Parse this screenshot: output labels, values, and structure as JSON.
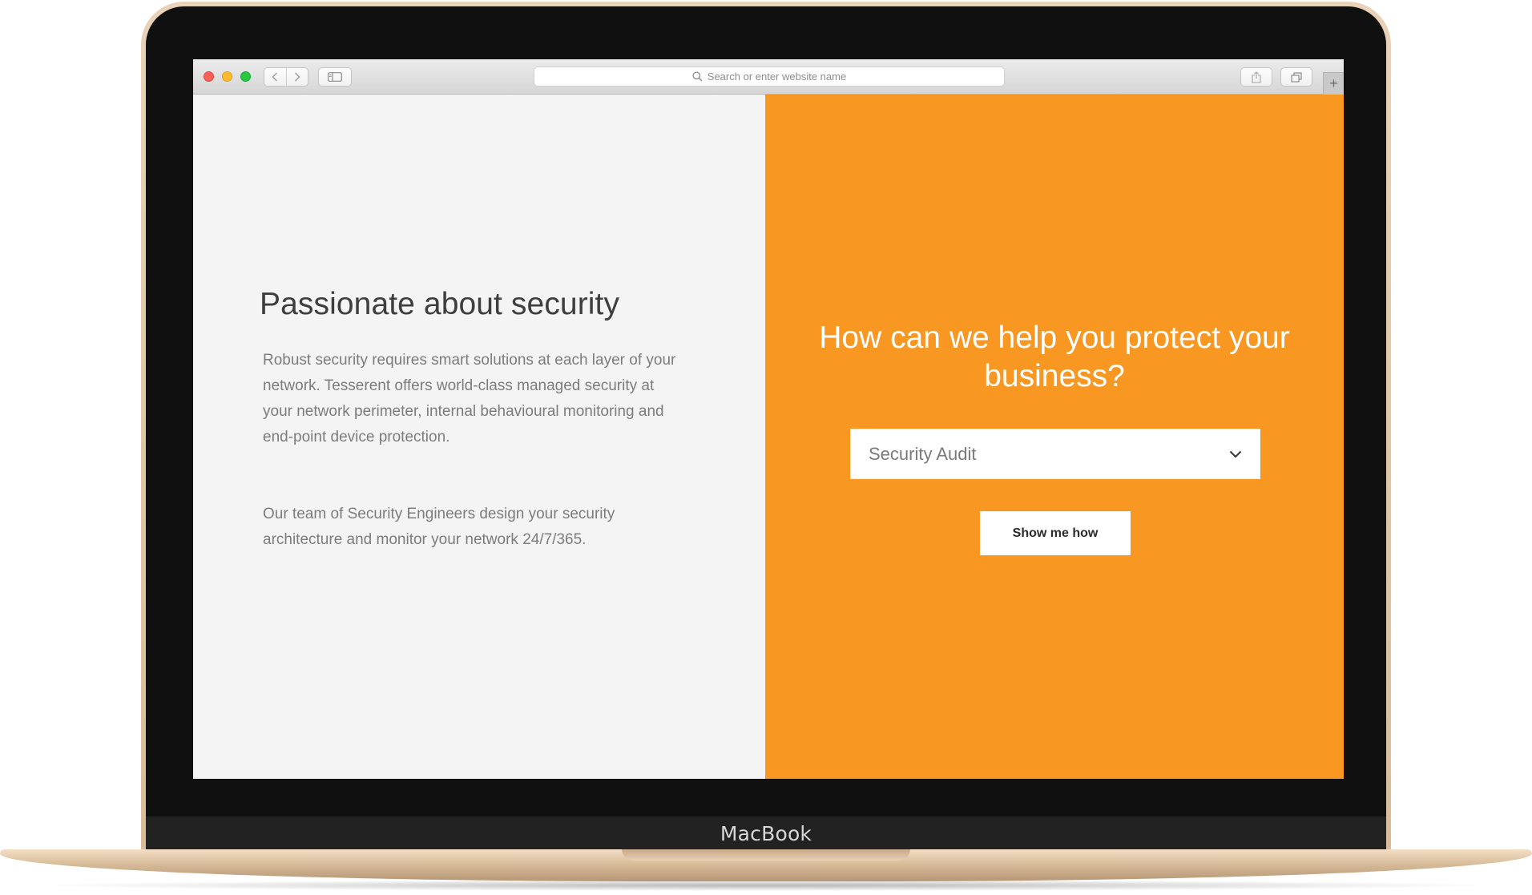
{
  "device": {
    "brand": "MacBook"
  },
  "browser": {
    "address_placeholder": "Search or enter website name",
    "new_tab_symbol": "+"
  },
  "page": {
    "about": {
      "title": "Passionate about security",
      "paragraph_1": "Robust security requires smart solutions at each layer of your network. Tesserent offers world-class managed security at your network perimeter, internal behavioural monitoring and end-point device protection.",
      "paragraph_2": "Our team of Security Engineers design your security architecture and monitor your network 24/7/365."
    },
    "cta": {
      "heading": "How can we help you protect your business?",
      "service_select": {
        "selected": "Security Audit"
      },
      "button_label": "Show me how"
    }
  },
  "colors": {
    "accent_orange": "#f89823",
    "left_background": "#f4f4f4",
    "heading_dark": "#3e3e3e",
    "body_text": "#7c7c7c"
  },
  "icons": [
    "back-arrow-icon",
    "forward-arrow-icon",
    "sidebar-icon",
    "search-icon",
    "share-icon",
    "tabs-overview-icon",
    "plus-icon",
    "chevron-down-icon"
  ]
}
